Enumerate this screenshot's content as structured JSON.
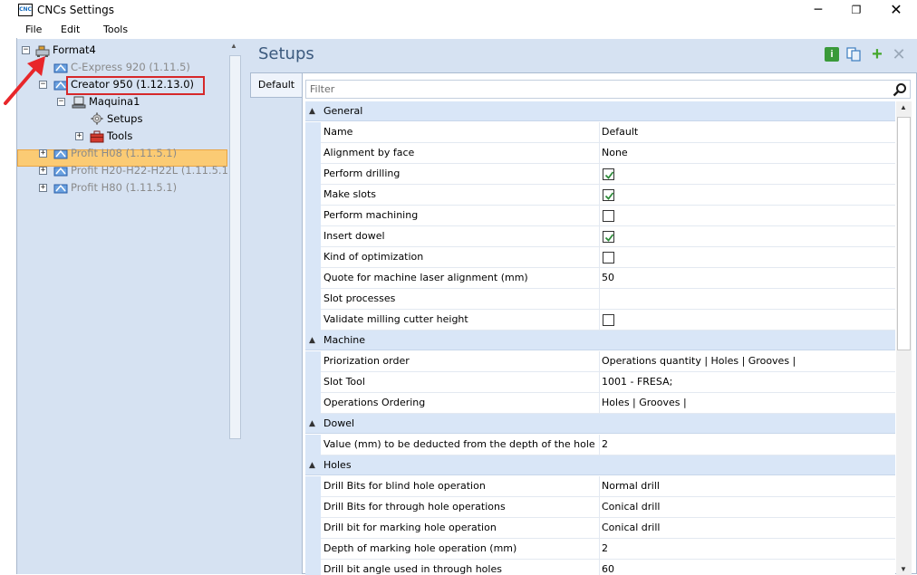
{
  "window": {
    "title": "CNCs Settings",
    "icon_text": "CNC",
    "controls": {
      "minimize": "─",
      "maximize": "❐",
      "close": "✕"
    }
  },
  "menu": {
    "file": "File",
    "edit": "Edit",
    "tools": "Tools"
  },
  "tree": {
    "root": "Format4",
    "items": [
      {
        "label": "C-Express 920 (1.11.5)"
      },
      {
        "label": "Creator 950 (1.12.13.0)"
      },
      {
        "label": "Maquina1"
      },
      {
        "label": "Setups"
      },
      {
        "label": "Tools"
      },
      {
        "label": "Profit H08 (1.11.5.1)"
      },
      {
        "label": "Profit H20-H22-H22L (1.11.5.1)"
      },
      {
        "label": "Profit H80 (1.11.5.1)"
      }
    ]
  },
  "main": {
    "title": "Setups",
    "tab": "Default",
    "filter_placeholder": "Filter",
    "icons": [
      "info-icon",
      "copy-icon",
      "add-icon",
      "delete-icon"
    ],
    "categories": [
      {
        "name": "General",
        "rows": [
          {
            "name": "Name",
            "value": "Default"
          },
          {
            "name": "Alignment by face",
            "value": "None"
          },
          {
            "name": "Perform drilling",
            "checked": true
          },
          {
            "name": "Make slots",
            "checked": true
          },
          {
            "name": "Perform machining",
            "checked": false
          },
          {
            "name": "Insert dowel",
            "checked": true
          },
          {
            "name": "Kind of optimization",
            "checked": false
          },
          {
            "name": "Quote for machine laser alignment (mm)",
            "value": "50"
          },
          {
            "name": "Slot processes",
            "value": ""
          },
          {
            "name": "Validate milling cutter height",
            "checked": false
          }
        ]
      },
      {
        "name": "Machine",
        "rows": [
          {
            "name": "Priorization order",
            "value": "Operations quantity | Holes | Grooves |"
          },
          {
            "name": "Slot Tool",
            "value": "1001 - FRESA;"
          },
          {
            "name": "Operations Ordering",
            "value": "Holes | Grooves |"
          }
        ]
      },
      {
        "name": "Dowel",
        "rows": [
          {
            "name": "Value (mm) to be deducted from the depth of the hole",
            "value": "2"
          }
        ]
      },
      {
        "name": "Holes",
        "rows": [
          {
            "name": "Drill Bits for blind hole operation",
            "value": "Normal drill"
          },
          {
            "name": "Drill Bits for through hole operations",
            "value": "Conical drill"
          },
          {
            "name": "Drill bit for marking hole operation",
            "value": "Conical drill"
          },
          {
            "name": "Depth of marking hole operation (mm)",
            "value": "2"
          },
          {
            "name": "Drill bit angle used in through holes",
            "value": "60"
          }
        ]
      }
    ]
  },
  "colors": {
    "panel_bg": "#d6e2f2",
    "selection": "#fbcb74",
    "highlight_box": "#d6282a",
    "annotation_arrow": "#e8262a",
    "header_text": "#3c5a7e"
  }
}
